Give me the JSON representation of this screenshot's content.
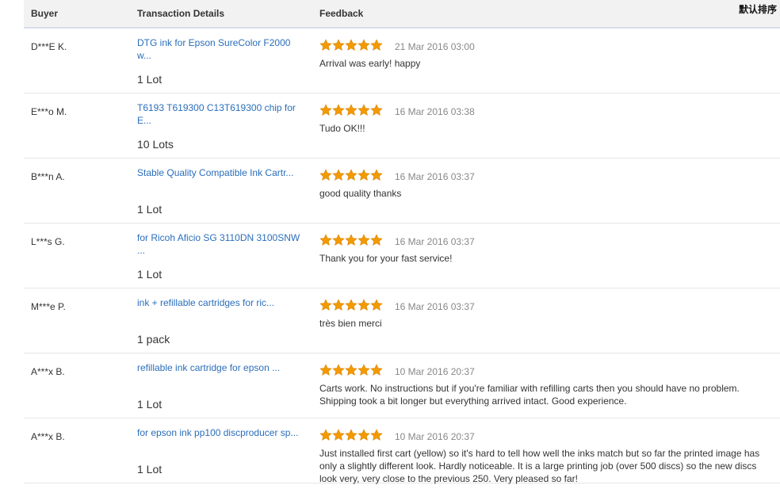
{
  "header": {
    "buyer": "Buyer",
    "transaction": "Transaction Details",
    "feedback": "Feedback",
    "sort_label": "默认排序"
  },
  "colors": {
    "link": "#2a6ebb",
    "star": "#f39a00",
    "date": "#888888"
  },
  "rows": [
    {
      "buyer": "D***E K.",
      "product": "DTG ink for Epson SureColor F2000 w...",
      "quantity": "1 Lot",
      "rating": 5,
      "date": "21 Mar 2016 03:00",
      "comment": "Arrival was early! happy"
    },
    {
      "buyer": "E***o M.",
      "product": "T6193 T619300 C13T619300 chip for E...",
      "quantity": "10 Lots",
      "rating": 5,
      "date": "16 Mar 2016 03:38",
      "comment": "Tudo OK!!!"
    },
    {
      "buyer": "B***n A.",
      "product": "Stable Quality Compatible Ink Cartr...",
      "quantity": "1 Lot",
      "rating": 5,
      "date": "16 Mar 2016 03:37",
      "comment": "good quality thanks"
    },
    {
      "buyer": "L***s G.",
      "product": "for Ricoh Aficio SG 3110DN 3100SNW ...",
      "quantity": "1 Lot",
      "rating": 5,
      "date": "16 Mar 2016 03:37",
      "comment": "Thank you for your fast service!"
    },
    {
      "buyer": "M***e P.",
      "product": "ink + refillable cartridges for ric...",
      "quantity": "1 pack",
      "rating": 5,
      "date": "16 Mar 2016 03:37",
      "comment": "très bien merci"
    },
    {
      "buyer": "A***x B.",
      "product": "refillable ink cartridge for epson ...",
      "quantity": "1 Lot",
      "rating": 5,
      "date": "10 Mar 2016 20:37",
      "comment": "Carts work. No instructions but if you're familiar with refilling carts then you should have no problem. Shipping took a bit longer but everything arrived intact. Good experience."
    },
    {
      "buyer": "A***x B.",
      "product": "for epson ink pp100 discproducer sp...",
      "quantity": "1 Lot",
      "rating": 5,
      "date": "10 Mar 2016 20:37",
      "comment": "Just installed first cart (yellow) so it's hard to tell how well the inks match but so far the printed image has only a slightly different look. Hardly noticeable. It is a large printing job (over 500 discs) so the new discs look very, very close to the previous 250. Very pleased so far!"
    }
  ]
}
